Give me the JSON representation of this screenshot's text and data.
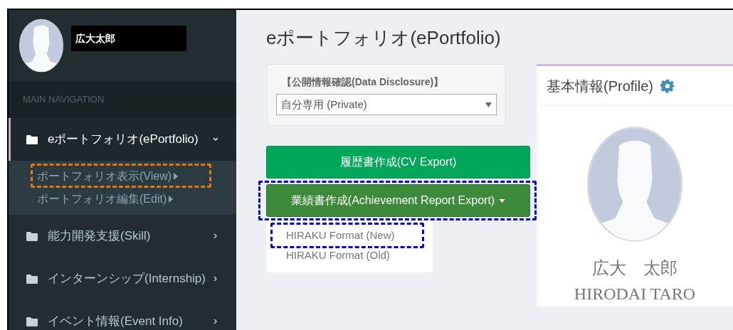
{
  "user_panel": {
    "name": "広大太郎"
  },
  "sidebar": {
    "header": "MAIN NAVIGATION",
    "items": [
      {
        "label": "eポートフォリオ(ePortfolio)",
        "expanded": true,
        "selected": true,
        "children": [
          {
            "label": "ポートフォリオ表示(View)",
            "marked": true
          },
          {
            "label": "ポートフォリオ編集(Edit)",
            "marked": false
          }
        ]
      },
      {
        "label": "能力開発支援(Skill)",
        "expanded": false,
        "selected": false
      },
      {
        "label": "インターンシップ(Internship)",
        "expanded": false,
        "selected": false
      },
      {
        "label": "イベント情報(Event Info)",
        "expanded": false,
        "selected": false
      }
    ]
  },
  "page_title": "eポートフォリオ(ePortfolio)",
  "disclosure": {
    "title": "【公開情報確認(Data Disclosure)】",
    "select_value": "自分専用 (Private)"
  },
  "buttons": [
    {
      "label": "履歴書作成(CV Export)",
      "kind": "primary",
      "marked": false
    },
    {
      "label": "業績書作成(Achievement Report Export)",
      "kind": "dropdown",
      "marked": true,
      "expanded": true
    }
  ],
  "dropdown_menu": [
    {
      "label": "HIRAKU Format (New)",
      "marked": true
    },
    {
      "label": "HIRAKU Format (Old)",
      "marked": false
    }
  ],
  "profile": {
    "title": "基本情報(Profile)",
    "name_ja": "広大　太郎",
    "name_en": "HIRODAI TARO"
  }
}
